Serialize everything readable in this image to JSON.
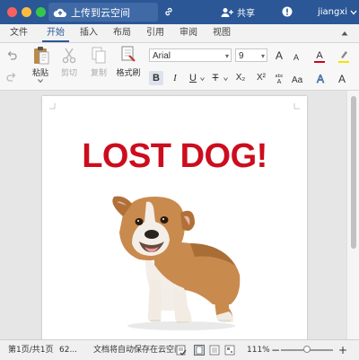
{
  "titlebar": {
    "upload_label": "上传到云空间",
    "share_label": "共享",
    "user_name": "jiangxi",
    "bg_color": "#2b5797"
  },
  "tabs": [
    {
      "label": "文件",
      "active": false
    },
    {
      "label": "开始",
      "active": true
    },
    {
      "label": "插入",
      "active": false
    },
    {
      "label": "布局",
      "active": false
    },
    {
      "label": "引用",
      "active": false
    },
    {
      "label": "审阅",
      "active": false
    },
    {
      "label": "视图",
      "active": false
    }
  ],
  "ribbon": {
    "paste_label": "粘贴",
    "cut_label": "剪切",
    "copy_label": "复制",
    "format_painter_label": "格式刷",
    "font_name": "Arial",
    "font_size": "9",
    "bold": "B",
    "italic": "I",
    "underline": "U",
    "strike": "T",
    "subscript": "X₂",
    "superscript": "X²",
    "grow_font": "A",
    "shrink_font": "A",
    "font_color_accent": "#d0021b",
    "highlight_accent": "#f5e400"
  },
  "document": {
    "heading": "LOST DOG!",
    "heading_color": "#cc0d1d"
  },
  "status": {
    "page_info": "第1页/共1页",
    "word_count": "62...",
    "save_status": "文档将自动保存在云空间",
    "zoom": "111%",
    "zoom_minus": "−",
    "zoom_plus": "+"
  }
}
